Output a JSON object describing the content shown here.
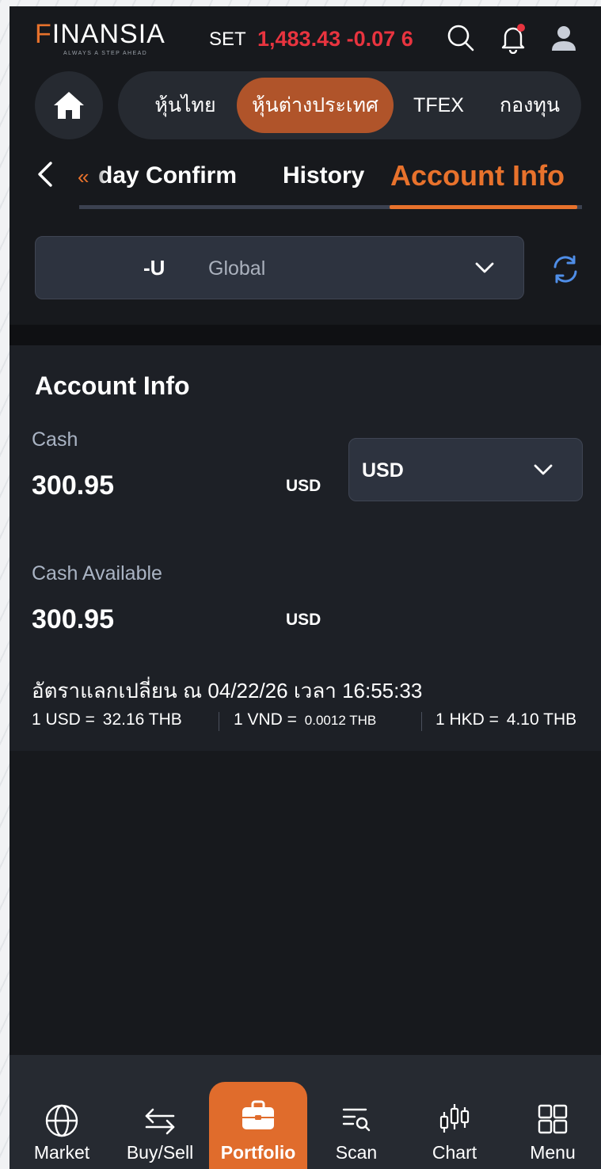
{
  "header": {
    "logo_mark": "F",
    "logo_text": "INANSIA",
    "logo_tagline": "ALWAYS A STEP AHEAD",
    "index_label": "SET",
    "index_value": "1,483.43",
    "index_change": "-0.07",
    "index_change_extra": "6",
    "icons": [
      "search-icon",
      "bell-icon",
      "user-icon"
    ],
    "notification_dot_color": "#e8343f"
  },
  "nav": {
    "tabs": [
      {
        "label": "หุ้นไทย",
        "active": false
      },
      {
        "label": "หุ้นต่างประเทศ",
        "active": true
      },
      {
        "label": "TFEX",
        "active": false
      },
      {
        "label": "กองทุน",
        "active": false
      }
    ]
  },
  "subtabs": {
    "items": [
      {
        "label": "day Confirm",
        "active": false
      },
      {
        "label": "History",
        "active": false
      },
      {
        "label": "Account Info",
        "active": true
      }
    ],
    "scroll_left_glyph": "«"
  },
  "account": {
    "id": "-U",
    "type": "Global"
  },
  "account_info": {
    "title": "Account Info",
    "cash_label": "Cash",
    "cash_value": "300.95",
    "cash_unit": "USD",
    "currency_selected": "USD",
    "cash_available_label": "Cash Available",
    "cash_available_value": "300.95",
    "cash_available_unit": "USD",
    "rate_title": "อัตราแลกเปลี่ยน ณ 04/22/26 เวลา 16:55:33",
    "rates": [
      {
        "base": "1 USD =",
        "value": "32.16 THB"
      },
      {
        "base": "1 VND =",
        "value": "0.0012 THB"
      },
      {
        "base": "1 HKD =",
        "value": "4.10 THB"
      }
    ]
  },
  "bottom_nav": {
    "items": [
      {
        "label": "Market",
        "icon": "globe-icon",
        "active": false
      },
      {
        "label": "Buy/Sell",
        "icon": "swap-arrows-icon",
        "active": false
      },
      {
        "label": "Portfolio",
        "icon": "briefcase-icon",
        "active": true
      },
      {
        "label": "Scan",
        "icon": "scan-filter-icon",
        "active": false
      },
      {
        "label": "Chart",
        "icon": "candlestick-icon",
        "active": false
      },
      {
        "label": "Menu",
        "icon": "grid-menu-icon",
        "active": false
      }
    ]
  },
  "colors": {
    "accent": "#e8722c",
    "background": "#17191d",
    "card": "#1d2026",
    "negative": "#e8343f"
  }
}
